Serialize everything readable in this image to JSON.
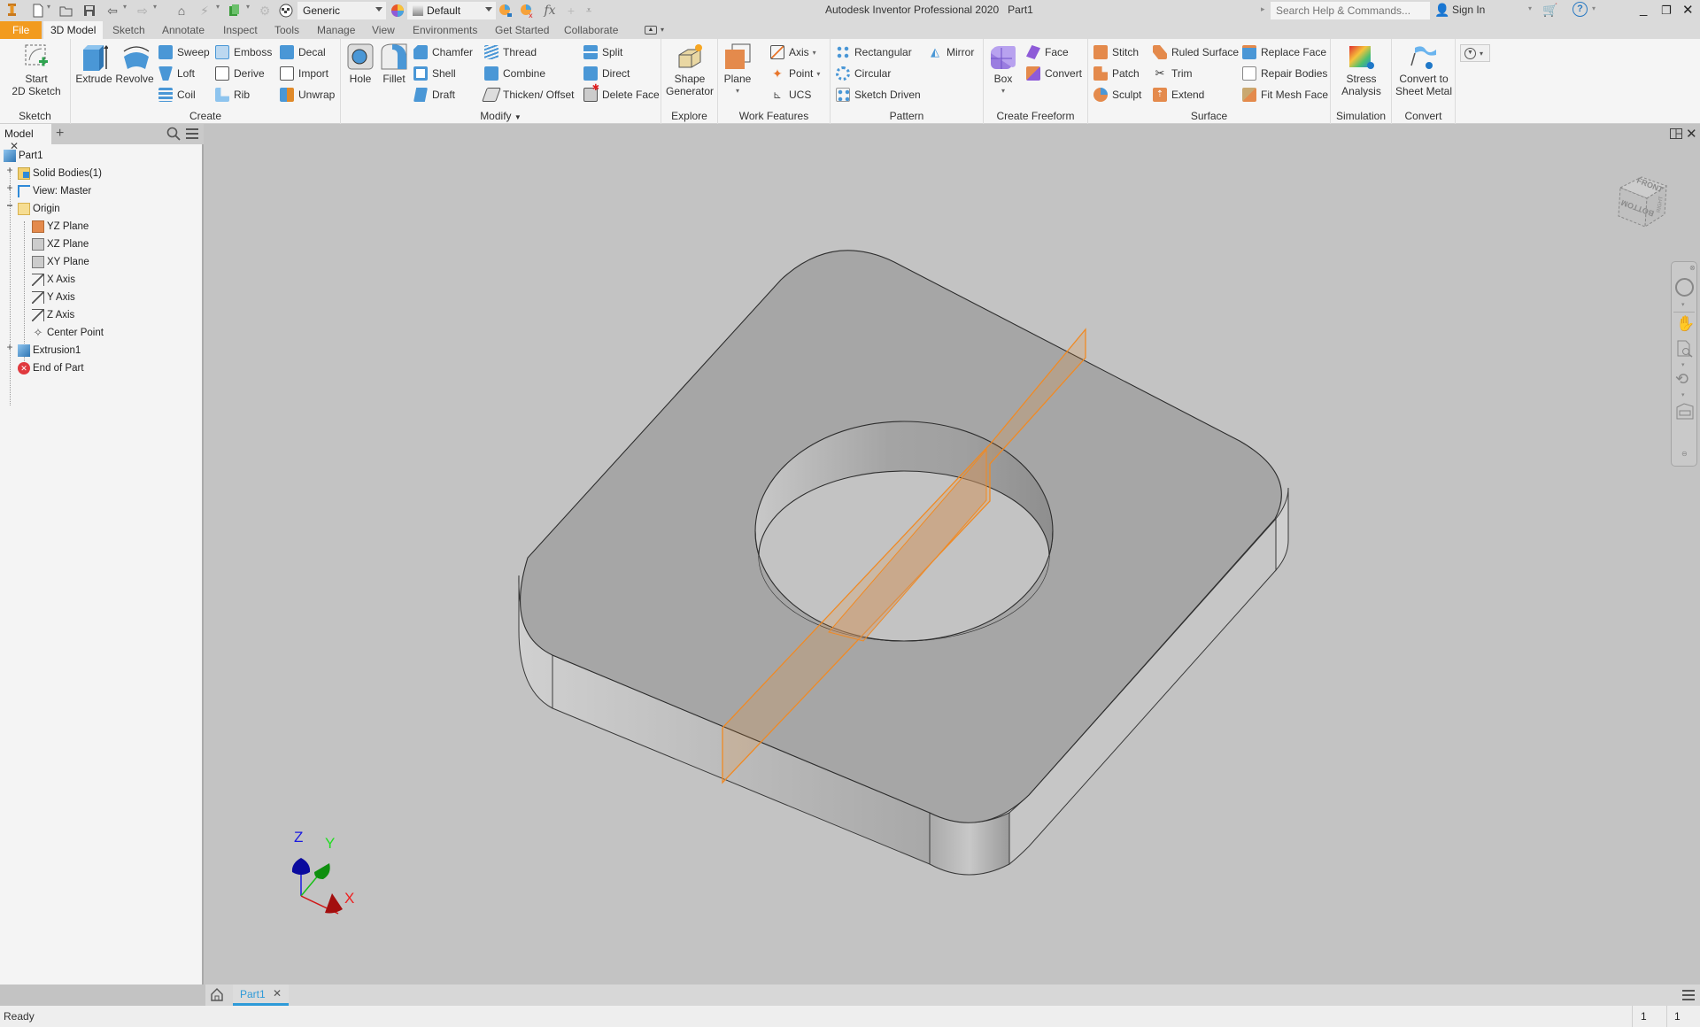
{
  "app": {
    "title": "Autodesk Inventor Professional 2020",
    "document": "Part1",
    "help_search_placeholder": "Search Help & Commands...",
    "sign_in": "Sign In"
  },
  "qat": {
    "material": "Generic",
    "appearance": "Default",
    "fx_label": "fx"
  },
  "ribbon_tabs": [
    {
      "label": "File"
    },
    {
      "label": "3D Model"
    },
    {
      "label": "Sketch"
    },
    {
      "label": "Annotate"
    },
    {
      "label": "Inspect"
    },
    {
      "label": "Tools"
    },
    {
      "label": "Manage"
    },
    {
      "label": "View"
    },
    {
      "label": "Environments"
    },
    {
      "label": "Get Started"
    },
    {
      "label": "Collaborate"
    }
  ],
  "ribbon": {
    "sketch": {
      "title": "Sketch",
      "start_2d_sketch": [
        "Start",
        "2D Sketch"
      ]
    },
    "create": {
      "title": "Create",
      "extrude": "Extrude",
      "revolve": "Revolve",
      "sweep": "Sweep",
      "loft": "Loft",
      "coil": "Coil",
      "emboss": "Emboss",
      "derive": "Derive",
      "rib": "Rib",
      "decal": "Decal",
      "import": "Import",
      "unwrap": "Unwrap"
    },
    "modify": {
      "title": "Modify",
      "hole": "Hole",
      "fillet": "Fillet",
      "chamfer": "Chamfer",
      "shell": "Shell",
      "draft": "Draft",
      "thread": "Thread",
      "combine": "Combine",
      "thicken": "Thicken/ Offset",
      "split": "Split",
      "direct": "Direct",
      "delete_face": "Delete Face"
    },
    "explore": {
      "title": "Explore",
      "shape_generator": [
        "Shape",
        "Generator"
      ]
    },
    "work_features": {
      "title": "Work Features",
      "plane": "Plane",
      "axis": "Axis",
      "point": "Point",
      "ucs": "UCS"
    },
    "pattern": {
      "title": "Pattern",
      "rectangular": "Rectangular",
      "circular": "Circular",
      "sketch_driven": "Sketch Driven",
      "mirror": "Mirror"
    },
    "create_freeform": {
      "title": "Create Freeform",
      "box": "Box",
      "face": "Face",
      "convert": "Convert"
    },
    "surface": {
      "title": "Surface",
      "stitch": "Stitch",
      "patch": "Patch",
      "sculpt": "Sculpt",
      "ruled_surface": "Ruled Surface",
      "trim": "Trim",
      "extend": "Extend",
      "replace_face": "Replace Face",
      "repair_bodies": "Repair Bodies",
      "fit_mesh_face": "Fit Mesh Face"
    },
    "simulation": {
      "title": "Simulation",
      "stress_analysis": [
        "Stress",
        "Analysis"
      ]
    },
    "convert": {
      "title": "Convert",
      "convert_sheet_metal": [
        "Convert to",
        "Sheet Metal"
      ]
    }
  },
  "browser": {
    "tab": "Model",
    "items": [
      {
        "label": "Part1",
        "icon": "part-icon"
      },
      {
        "label": "Solid Bodies(1)",
        "icon": "folder-icon"
      },
      {
        "label": "View: Master",
        "icon": "view-icon"
      },
      {
        "label": "Origin",
        "icon": "folder-open-icon"
      },
      {
        "label": "YZ Plane",
        "icon": "plane-icon"
      },
      {
        "label": "XZ Plane",
        "icon": "plane-icon"
      },
      {
        "label": "XY Plane",
        "icon": "plane-icon"
      },
      {
        "label": "X Axis",
        "icon": "axis-icon"
      },
      {
        "label": "Y Axis",
        "icon": "axis-icon"
      },
      {
        "label": "Z Axis",
        "icon": "axis-icon"
      },
      {
        "label": "Center Point",
        "icon": "point-icon"
      },
      {
        "label": "Extrusion1",
        "icon": "extrusion-icon"
      },
      {
        "label": "End of Part",
        "icon": "end-of-part-icon"
      }
    ]
  },
  "viewcube": {
    "front": "FRONT",
    "bottom": "BOTTOM",
    "right": "RIGHT"
  },
  "triad": {
    "x": "X",
    "y": "Y",
    "z": "Z"
  },
  "doc_tabs": [
    {
      "label": "Part1",
      "active": true
    }
  ],
  "status": {
    "text": "Ready",
    "count1": "1",
    "count2": "1"
  },
  "colors": {
    "accent_file": "#f29b1f",
    "tab_underline": "#2e9ad8",
    "work_plane": "#f08a24"
  }
}
